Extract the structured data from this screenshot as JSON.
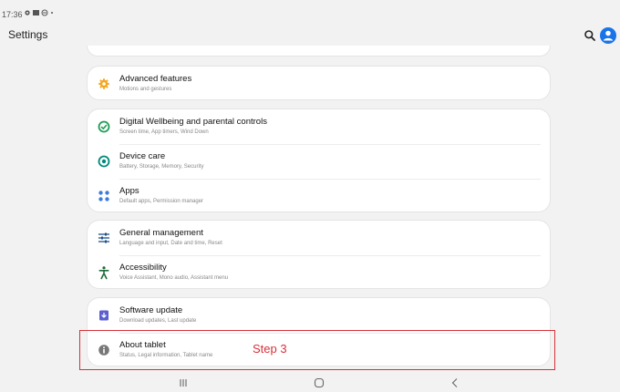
{
  "status_bar": {
    "time": "17:36",
    "icons": [
      "gear-icon",
      "image-icon",
      "dnd-icon",
      "dot-icon"
    ]
  },
  "header": {
    "title": "Settings"
  },
  "colors": {
    "accent_blue": "#1a73e8",
    "orange": "#f5a623",
    "green": "#1f9d55",
    "teal": "#00897b",
    "blue": "#3d7be0",
    "dark_green": "#1e6b3a",
    "purple": "#5b5fcf",
    "gray": "#777777",
    "annotation_red": "#d6303a"
  },
  "groups": [
    {
      "items": [
        {
          "icon": "gear-icon",
          "label": "Advanced features",
          "sub": "Motions and gestures"
        }
      ]
    },
    {
      "items": [
        {
          "icon": "wellbeing-icon",
          "label": "Digital Wellbeing and parental controls",
          "sub": "Screen time, App timers, Wind Down"
        },
        {
          "icon": "device-care-icon",
          "label": "Device care",
          "sub": "Battery, Storage, Memory, Security"
        },
        {
          "icon": "apps-icon",
          "label": "Apps",
          "sub": "Default apps, Permission manager"
        }
      ]
    },
    {
      "items": [
        {
          "icon": "sliders-icon",
          "label": "General management",
          "sub": "Language and input, Date and time, Reset"
        },
        {
          "icon": "accessibility-icon",
          "label": "Accessibility",
          "sub": "Voice Assistant, Mono audio, Assistant menu"
        }
      ]
    },
    {
      "items": [
        {
          "icon": "software-update-icon",
          "label": "Software update",
          "sub": "Download updates, Last update"
        },
        {
          "icon": "info-icon",
          "label": "About tablet",
          "sub": "Status, Legal information, Tablet name"
        }
      ]
    }
  ],
  "annotation": {
    "step_label": "Step 3"
  },
  "navbar": {
    "icons": [
      "recents-icon",
      "home-icon",
      "back-icon"
    ]
  }
}
